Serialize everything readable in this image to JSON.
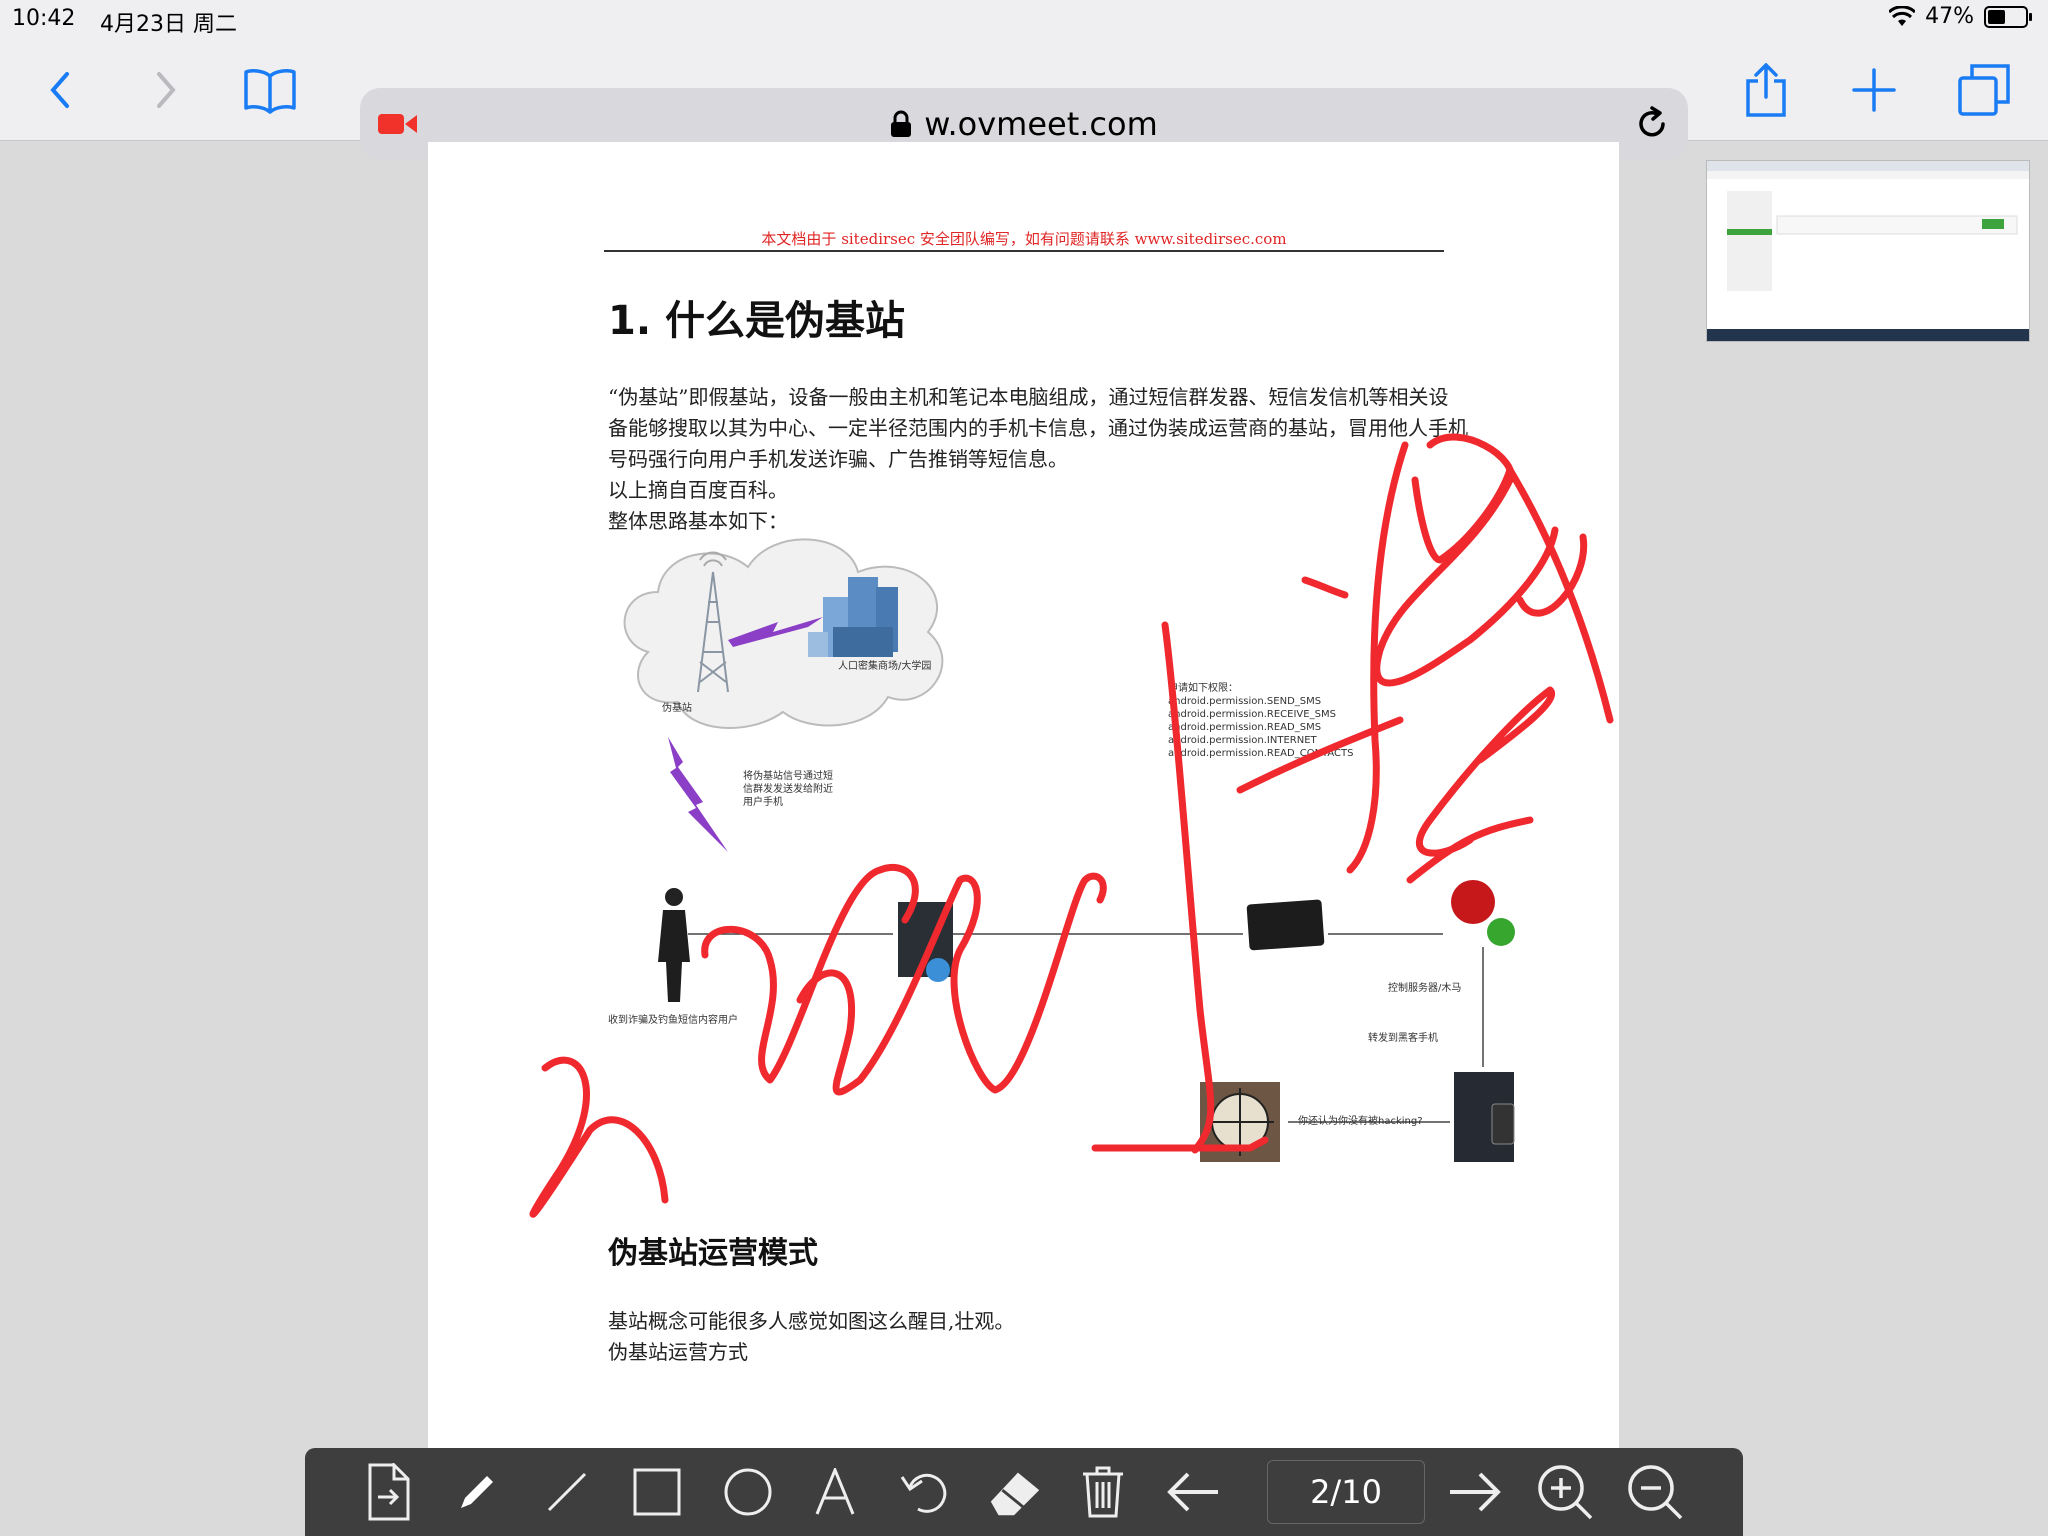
{
  "status": {
    "time": "10:42",
    "date": "4月23日 周二",
    "battery": "47%",
    "battery_level": 0.47
  },
  "browser": {
    "url": "w.ovmeet.com",
    "url_color": "#000000",
    "accent": "#1a7cf5"
  },
  "doc": {
    "header": "本文档由于 sitedirsec 安全团队编写，如有问题请联系 www.sitedirsec.com",
    "title": "1. 什么是伪基站",
    "para1": "“伪基站”即假基站，设备一般由主机和笔记本电脑组成，通过短信群发器、短信发信机等相关设备能够搜取以其为中心、一定半径范围内的手机卡信息，通过伪装成运营商的基站，冒用他人手机号码强行向用户手机发送诈骗、广告推销等短信息。",
    "para2": "以上摘自百度百科。",
    "para3": "整体思路基本如下：",
    "diagram": {
      "tower_label": "伪基站",
      "building_label": "人口密集商场/大学园",
      "wave_label": "将伪基站信号通过短信群发发送发给附近用户手机",
      "person_label": "收到诈骗及钓鱼短信内容用户",
      "perms_label": "申请如下权限：android.permission.SEND_SMS android.permission.RECEIVE_SMS android.permission.READ_SMS android.permission.INTERNET android.permission.READ_CONTACTS",
      "hacker_q": "你还认为你没有被hacking?",
      "server_label": "控制服务器/木马",
      "phone_label": "转发到黑客手机"
    },
    "h2": "伪基站运营模式",
    "para4": "基站概念可能很多人感觉如图这么醒目,壮观。",
    "para5": "伪基站运营方式"
  },
  "toolbar": {
    "page_indicator": "2/10",
    "tools": [
      "export-icon",
      "pencil-icon",
      "line-icon",
      "rectangle-icon",
      "circle-icon",
      "text-icon",
      "undo-icon",
      "eraser-icon",
      "trash-icon",
      "prev-page-icon",
      "next-page-icon",
      "zoom-in-icon",
      "zoom-out-icon"
    ]
  },
  "annotation": {
    "color": "#f0292f"
  }
}
